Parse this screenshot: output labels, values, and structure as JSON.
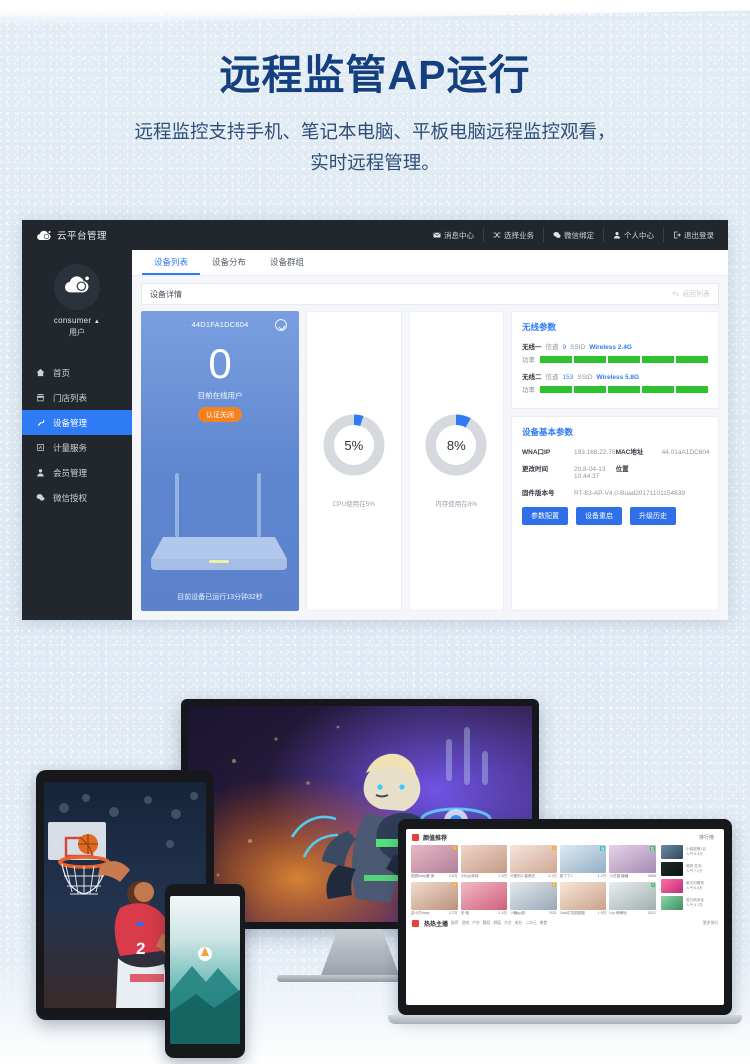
{
  "hero": {
    "title": "远程监管AP运行",
    "subtitle_line1": "远程监控支持手机、笔记本电脑、平板电脑远程监控观看，",
    "subtitle_line2": "实时远程管理。"
  },
  "admin": {
    "topbar": {
      "brand": "云平台管理",
      "nav": [
        {
          "label": "消息中心",
          "icon": "mail-icon"
        },
        {
          "label": "选择业务",
          "icon": "shuffle-icon"
        },
        {
          "label": "微信绑定",
          "icon": "wechat-icon"
        },
        {
          "label": "个人中心",
          "icon": "user-icon"
        },
        {
          "label": "退出登录",
          "icon": "logout-icon"
        }
      ]
    },
    "sidebar": {
      "username": "consumer",
      "caret": "▲",
      "role": "用户",
      "items": [
        {
          "label": "首页",
          "icon": "home-icon",
          "active": false
        },
        {
          "label": "门店列表",
          "icon": "store-icon",
          "active": false
        },
        {
          "label": "设备管理",
          "icon": "wrench-icon",
          "active": true
        },
        {
          "label": "计量服务",
          "icon": "meter-icon",
          "active": false
        },
        {
          "label": "会员管理",
          "icon": "member-icon",
          "active": false
        },
        {
          "label": "微信授权",
          "icon": "wechat-icon",
          "active": false
        }
      ]
    },
    "tabs": [
      {
        "label": "设备列表",
        "active": true
      },
      {
        "label": "设备分布",
        "active": false
      },
      {
        "label": "设备群组",
        "active": false
      }
    ],
    "subhead": {
      "title": "设备详情",
      "back_label": "返回列表"
    },
    "device_card": {
      "mac_title": "44D1FA1DC604",
      "online_count": "0",
      "online_label": "目前在线用户",
      "auth_badge": "认证关闭",
      "uptime": "目前设备已运行13分钟32秒"
    },
    "gauges": [
      {
        "name": "cpu",
        "value": "5%",
        "percent": 5,
        "caption": "CPU使用在5%"
      },
      {
        "name": "memory",
        "value": "8%",
        "percent": 8,
        "caption": "内存使用在8%"
      }
    ],
    "wireless": {
      "title": "无线参数",
      "radios": [
        {
          "name": "无线一",
          "channel_label": "信道",
          "channel": "9",
          "ssid_label": "SSID",
          "ssid": "Wireless 2.4G",
          "power_label": "功率",
          "power_bars": 5
        },
        {
          "name": "无线二",
          "channel_label": "信道",
          "channel": "153",
          "ssid_label": "SSID",
          "ssid": "Wireless 5.8G",
          "power_label": "功率",
          "power_bars": 5
        }
      ]
    },
    "basic": {
      "title": "设备基本参数",
      "fields": [
        {
          "key": "WNA口IP",
          "value": "193.168.22.78"
        },
        {
          "key": "MAC地址",
          "value": "44.01aA1DC604"
        },
        {
          "key": "更改时间",
          "value": "20.8-04-13 10.44.37"
        },
        {
          "key": "位置",
          "value": ""
        },
        {
          "key": "固件版本号",
          "value": "RT-83-AP-V4.0-Buad20171101154639"
        }
      ],
      "buttons": [
        "参数配置",
        "设备重启",
        "升级历史"
      ]
    }
  },
  "mockups": {
    "imac": {
      "name": "desktop-imac",
      "content": "game-character-artwork"
    },
    "tablet": {
      "name": "tablet-device",
      "content": "basketball-dunk-photo"
    },
    "phone": {
      "name": "smartphone-device",
      "content": "gradient-mountain-wallpaper"
    },
    "laptop": {
      "name": "laptop-device",
      "page": {
        "header_title": "颜值推荐",
        "right_title": "排行榜",
        "footer_title": "热热主播",
        "footer_tags": [
          "推荐",
          "游戏",
          "户外",
          "舞蹈",
          "颜值",
          "才艺",
          "电台",
          "二次元",
          "美食",
          "萌宠",
          "其他"
        ],
        "right_more": "更多排行",
        "grid": [
          {
            "caption": "甜甜baby酱·美",
            "viewers": "2.6万"
          },
          {
            "caption": "小仙女妹妹",
            "viewers": "1.8万"
          },
          {
            "caption": "可爱的小星蛋花",
            "viewers": "3.1万"
          },
          {
            "caption": "夏了了L",
            "viewers": "1.2万"
          },
          {
            "caption": "小花猫 糖糖",
            "viewers": "9856"
          },
          {
            "caption": "金小莎baby",
            "viewers": "2.2万"
          },
          {
            "caption": "安·薇",
            "viewers": "1.4万"
          },
          {
            "caption": "小糖go甜",
            "viewers": "7621"
          },
          {
            "caption": "Zala花花甜甜圈",
            "viewers": "1.9万"
          },
          {
            "caption": "Lily·萌萌哒",
            "viewers": "5312"
          }
        ],
        "side": [
          {
            "title": "小甜甜第1名",
            "sub": "人气 8.9万"
          },
          {
            "title": "暗夜·狂欢",
            "sub": "人气 7.2万"
          },
          {
            "title": "星光闪耀夜",
            "sub": "人气 6.4万"
          },
          {
            "title": "夏日纳凉会",
            "sub": "人气 5.1万"
          }
        ]
      }
    }
  },
  "colors": {
    "headline": "#15407f",
    "accent_blue": "#2f7bf6",
    "sidebar_bg": "#22262d",
    "badge_orange": "#f5821f",
    "bar_green": "#2ec32e"
  }
}
